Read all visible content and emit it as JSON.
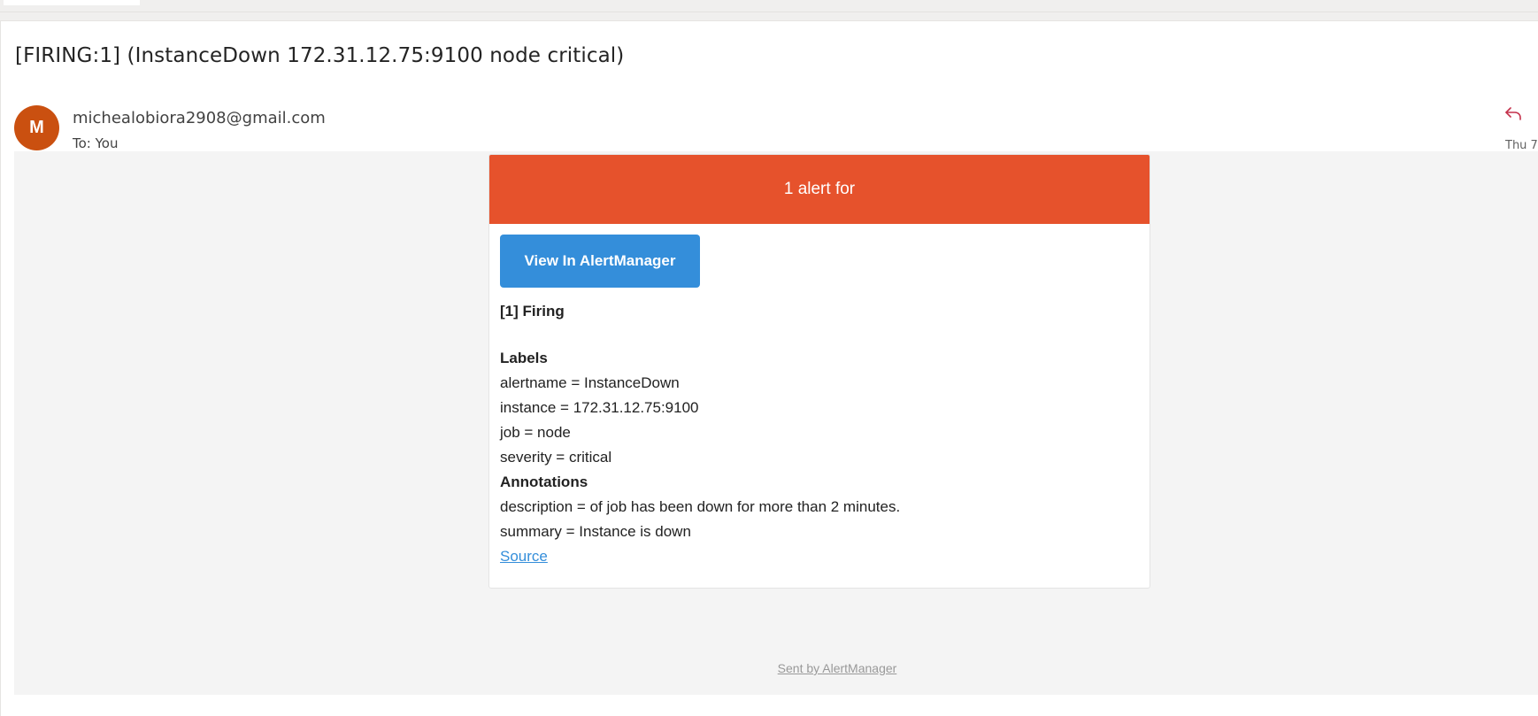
{
  "email": {
    "subject": "[FIRING:1] (InstanceDown 172.31.12.75:9100 node critical)",
    "sender": "michealobiora2908@gmail.com",
    "avatar_initial": "M",
    "avatar_color": "#ca5010",
    "to_line": "To:  You",
    "date": "Thu 7",
    "reply_icon": "reply-icon"
  },
  "alert_card": {
    "header_text": "1 alert for",
    "header_color": "#e6522c",
    "button_label": "View In AlertManager",
    "button_color": "#348eda",
    "firing_title": "[1] Firing",
    "labels_heading": "Labels",
    "labels": [
      "alertname = InstanceDown",
      "instance = 172.31.12.75:9100",
      "job = node",
      "severity = critical"
    ],
    "annotations_heading": "Annotations",
    "annotations": [
      "description = of job has been down for more than 2 minutes.",
      "summary = Instance is down"
    ],
    "source_link": "Source"
  },
  "footer": {
    "sent_by": "Sent by AlertManager"
  }
}
